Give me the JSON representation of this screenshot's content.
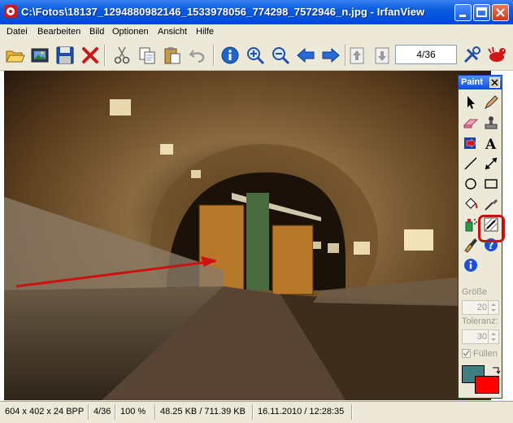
{
  "window": {
    "title": "C:\\Fotos\\18137_1294880982146_1533978056_774298_7572946_n.jpg - IrfanView"
  },
  "menu": [
    "Datei",
    "Bearbeiten",
    "Bild",
    "Optionen",
    "Ansicht",
    "Hilfe"
  ],
  "toolbar": {
    "counter": "4/36",
    "icons": [
      "open-folder",
      "slideshow",
      "save",
      "delete",
      "cut",
      "copy",
      "paste",
      "undo",
      "info",
      "zoom-in",
      "zoom-out",
      "previous",
      "next",
      "page-up",
      "page-down",
      "properties",
      "irfanview-logo"
    ]
  },
  "paint": {
    "title": "Paint",
    "tools": [
      "selection-arrow",
      "pencil",
      "eraser",
      "stamp",
      "red-eye",
      "text",
      "line",
      "arrow",
      "circle",
      "rectangle",
      "fill-bucket",
      "color-picker",
      "spray",
      "effects-brush",
      "emboss",
      "help",
      "info"
    ],
    "size_label": "Größe",
    "size_value": "20",
    "tolerance_label": "Toleranz:",
    "tolerance_value": "30",
    "fill_label": "Füllen",
    "fill_checked": true,
    "fg_color": "#3f7f7f",
    "bg_color": "#ff0000"
  },
  "statusbar": {
    "dimensions": "604 x 402 x 24 BPP",
    "position": "4/36",
    "zoom": "100 %",
    "filesize": "48.25 KB / 711.39 KB",
    "datetime": "16.11.2010 / 12:28:35"
  },
  "colors": {
    "highlight": "#c81010",
    "arrow": "#d01010"
  }
}
